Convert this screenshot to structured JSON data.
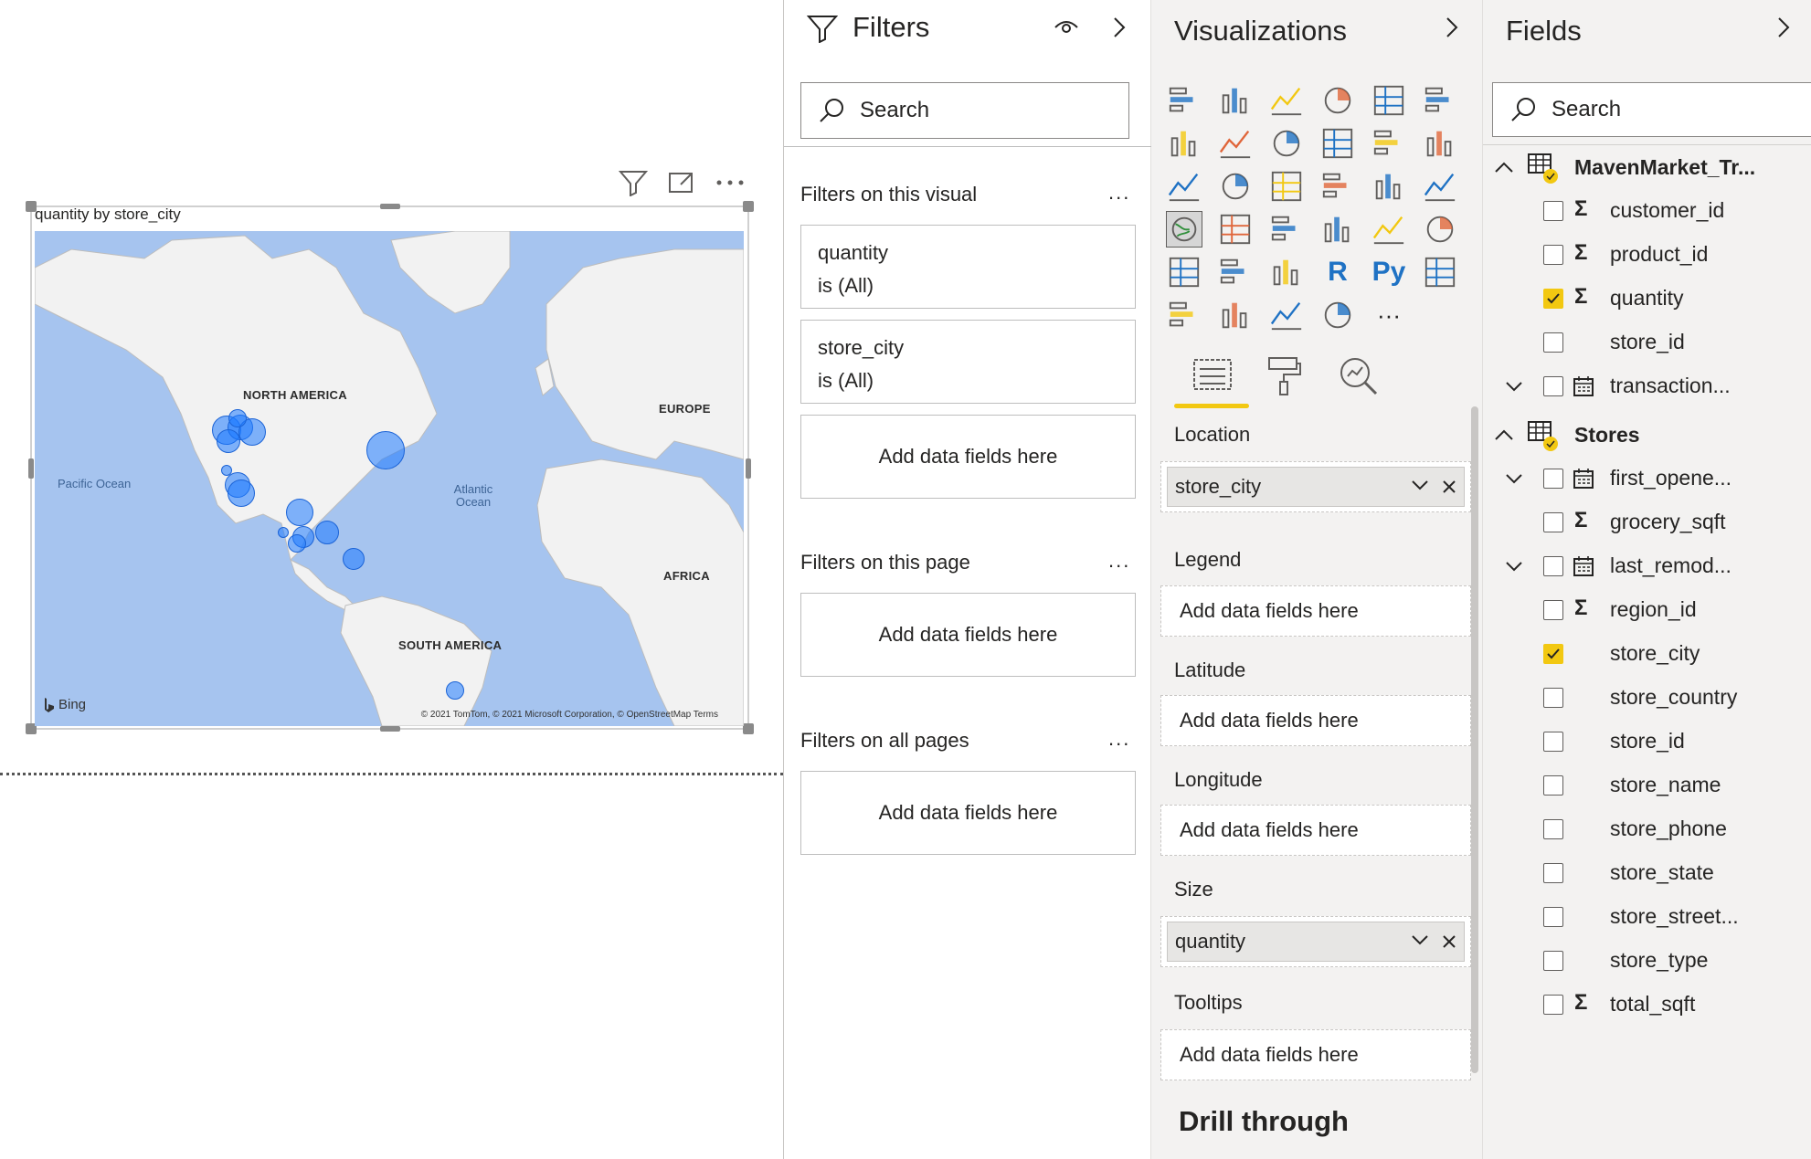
{
  "visual": {
    "title": "quantity by store_city",
    "bing": "Bing",
    "copyright": "© 2021 TomTom, © 2021 Microsoft Corporation, © OpenStreetMap Terms",
    "map_labels": {
      "north_america": "NORTH AMERICA",
      "europe": "EUROPE",
      "africa": "AFRICA",
      "south_america": "SOUTH AMERICA",
      "pacific": "Pacific Ocean",
      "atlantic": "Atlantic Ocean"
    }
  },
  "filters": {
    "title": "Filters",
    "search_placeholder": "Search",
    "on_visual_label": "Filters on this visual",
    "cards": [
      {
        "field": "quantity",
        "state": "is (All)"
      },
      {
        "field": "store_city",
        "state": "is (All)"
      }
    ],
    "add_fields": "Add data fields here",
    "on_page_label": "Filters on this page",
    "all_pages_label": "Filters on all pages",
    "more": "..."
  },
  "viz": {
    "title": "Visualizations",
    "icon_names": [
      "stacked-bar",
      "stacked-column",
      "clustered-bar",
      "clustered-column",
      "100-bar",
      "100-column",
      "line",
      "area",
      "stacked-area",
      "line-column",
      "line-cluster-column",
      "ribbon",
      "waterfall",
      "funnel",
      "scatter",
      "pie",
      "donut",
      "treemap",
      "map",
      "filled-map",
      "gauge",
      "card",
      "multi-row-card",
      "kpi",
      "slicer",
      "table",
      "matrix",
      "r-visual",
      "python-visual",
      "key-influencers",
      "decomposition-tree",
      "qa",
      "arcgis",
      "power-apps",
      "more"
    ],
    "r_label": "R",
    "py_label": "Py",
    "more_label": "···",
    "wells": [
      {
        "label": "Location",
        "value": "store_city"
      },
      {
        "label": "Legend",
        "value": ""
      },
      {
        "label": "Latitude",
        "value": ""
      },
      {
        "label": "Longitude",
        "value": ""
      },
      {
        "label": "Size",
        "value": "quantity"
      },
      {
        "label": "Tooltips",
        "value": ""
      }
    ],
    "add_fields": "Add data fields here",
    "drill_through": "Drill through"
  },
  "fields": {
    "title": "Fields",
    "search_placeholder": "Search",
    "tables": [
      {
        "name": "MavenMarket_Tr...",
        "items": [
          {
            "name": "customer_id",
            "type": "sigma",
            "checked": false
          },
          {
            "name": "product_id",
            "type": "sigma",
            "checked": false
          },
          {
            "name": "quantity",
            "type": "sigma",
            "checked": true
          },
          {
            "name": "store_id",
            "type": "none",
            "checked": false
          },
          {
            "name": "transaction...",
            "type": "date",
            "checked": false
          }
        ]
      },
      {
        "name": "Stores",
        "items": [
          {
            "name": "first_opene...",
            "type": "date",
            "checked": false
          },
          {
            "name": "grocery_sqft",
            "type": "sigma",
            "checked": false
          },
          {
            "name": "last_remod...",
            "type": "date",
            "checked": false
          },
          {
            "name": "region_id",
            "type": "sigma",
            "checked": false
          },
          {
            "name": "store_city",
            "type": "none",
            "checked": true
          },
          {
            "name": "store_country",
            "type": "none",
            "checked": false
          },
          {
            "name": "store_id",
            "type": "none",
            "checked": false
          },
          {
            "name": "store_name",
            "type": "none",
            "checked": false
          },
          {
            "name": "store_phone",
            "type": "none",
            "checked": false
          },
          {
            "name": "store_state",
            "type": "none",
            "checked": false
          },
          {
            "name": "store_street...",
            "type": "none",
            "checked": false
          },
          {
            "name": "store_type",
            "type": "none",
            "checked": false
          },
          {
            "name": "total_sqft",
            "type": "sigma",
            "checked": false
          }
        ]
      }
    ]
  },
  "colors": {
    "accent": "#f2c811",
    "bubble": "#1e7aff",
    "ocean": "#a6c4ef",
    "land": "#f2f2f2"
  }
}
